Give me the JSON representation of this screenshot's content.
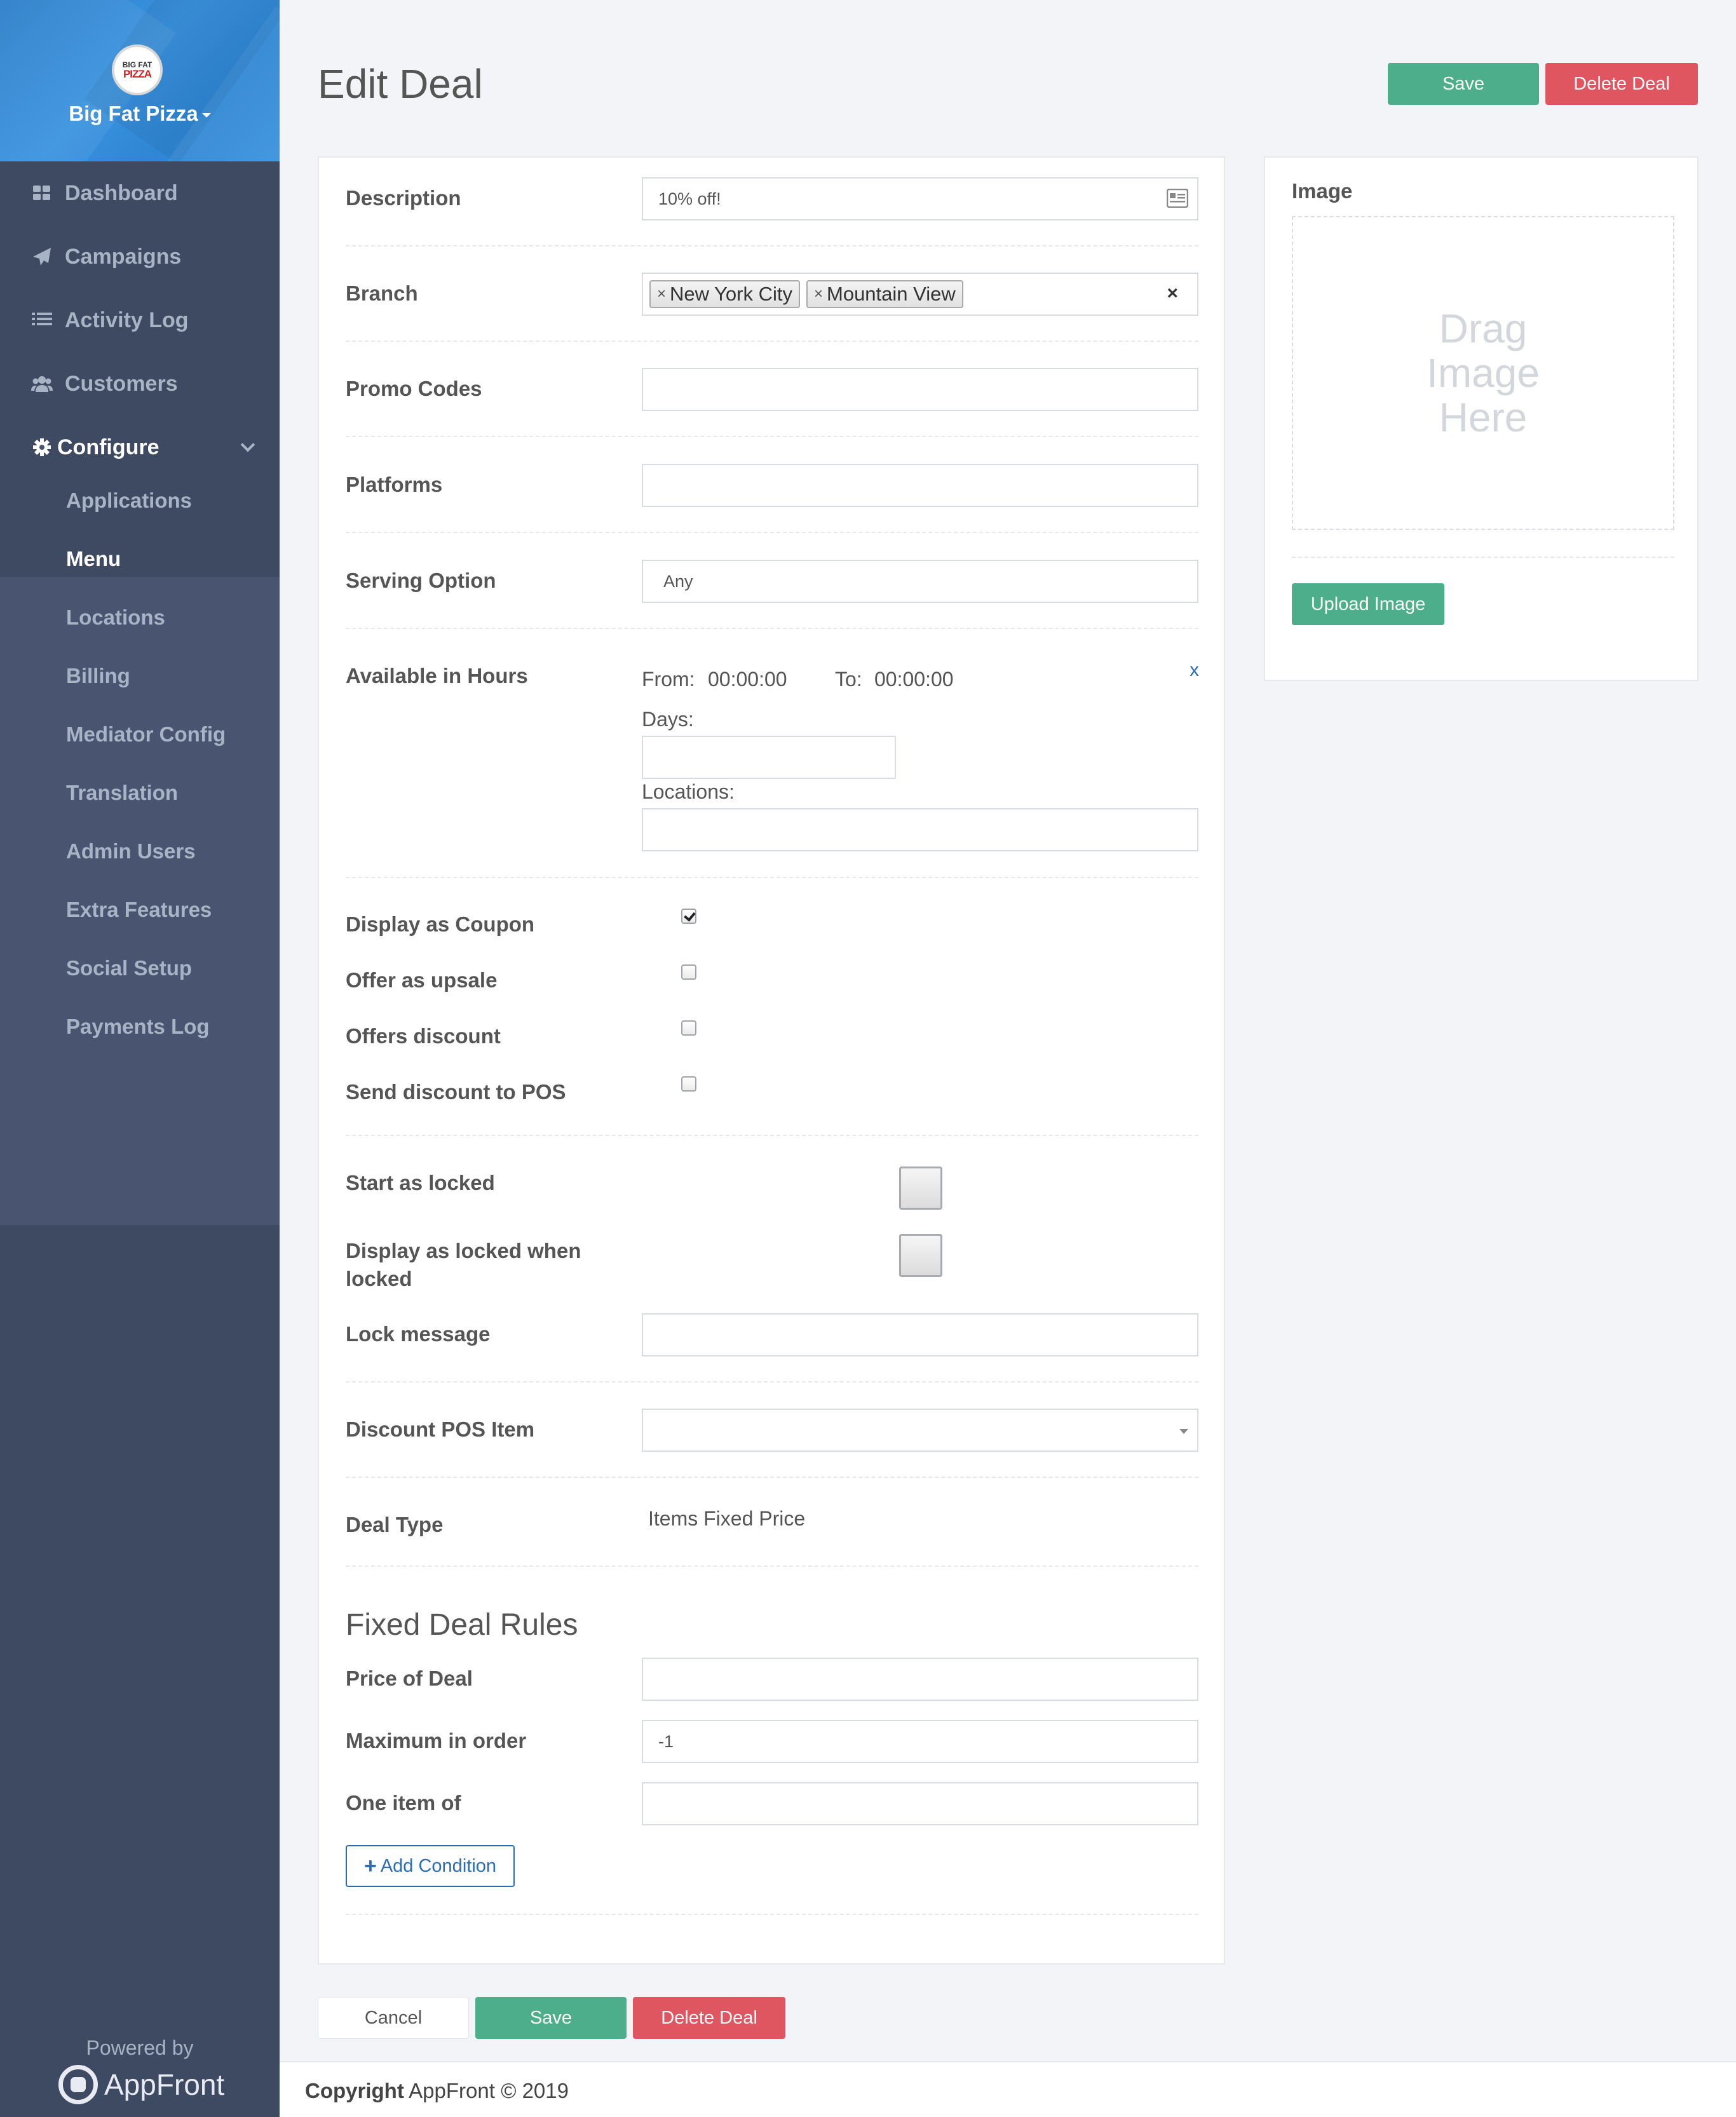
{
  "sidebar": {
    "logo_line1": "BIG FAT",
    "logo_line2": "PIZZA",
    "brand_name": "Big Fat Pizza",
    "nav": [
      {
        "label": "Dashboard",
        "icon": "dashboard-icon"
      },
      {
        "label": "Campaigns",
        "icon": "paper-plane-icon"
      },
      {
        "label": "Activity Log",
        "icon": "list-icon"
      },
      {
        "label": "Customers",
        "icon": "users-icon"
      },
      {
        "label": "Configure",
        "icon": "gear-icon",
        "expanded": true
      }
    ],
    "subnav": [
      "Applications",
      "Menu",
      "Locations",
      "Billing",
      "Mediator Config",
      "Translation",
      "Admin Users",
      "Extra Features",
      "Social Setup",
      "Payments Log"
    ],
    "active_subnav": "Menu",
    "powered_by": "Powered by",
    "powered_brand": "AppFront"
  },
  "header": {
    "title": "Edit Deal",
    "save_label": "Save",
    "delete_label": "Delete Deal"
  },
  "form": {
    "description": {
      "label": "Description",
      "value": "10% off!"
    },
    "branch": {
      "label": "Branch",
      "tags": [
        "New York City",
        "Mountain View"
      ],
      "clear": "×"
    },
    "promo_codes": {
      "label": "Promo Codes",
      "value": ""
    },
    "platforms": {
      "label": "Platforms",
      "value": ""
    },
    "serving_option": {
      "label": "Serving Option",
      "value": "Any"
    },
    "available_hours": {
      "label": "Available in Hours",
      "from_label": "From:",
      "from_value": "00:00:00",
      "to_label": "To:",
      "to_value": "00:00:00",
      "remove": "x",
      "days_label": "Days:",
      "locations_label": "Locations:"
    },
    "display_as_coupon": {
      "label": "Display as Coupon",
      "checked": true
    },
    "offer_as_upsale": {
      "label": "Offer as upsale",
      "checked": false
    },
    "offers_discount": {
      "label": "Offers discount",
      "checked": false
    },
    "send_discount_to_pos": {
      "label": "Send discount to POS",
      "checked": false
    },
    "start_as_locked": {
      "label": "Start as locked"
    },
    "display_as_locked": {
      "label_line1": "Display as locked when",
      "label_line2": "locked"
    },
    "lock_message": {
      "label": "Lock message",
      "value": ""
    },
    "discount_pos_item": {
      "label": "Discount POS Item",
      "value": ""
    },
    "deal_type": {
      "label": "Deal Type",
      "value": "Items Fixed Price"
    },
    "fixed_rules_heading": "Fixed Deal Rules",
    "price_of_deal": {
      "label": "Price of Deal",
      "value": ""
    },
    "maximum_in_order": {
      "label": "Maximum in order",
      "value": "-1"
    },
    "one_item_of": {
      "label": "One item of",
      "value": ""
    },
    "add_condition": "Add Condition"
  },
  "image_panel": {
    "label": "Image",
    "drop_line1": "Drag",
    "drop_line2": "Image",
    "drop_line3": "Here",
    "upload_label": "Upload Image"
  },
  "bottom_actions": {
    "cancel_label": "Cancel",
    "save_label": "Save",
    "delete_label": "Delete Deal"
  },
  "footer": {
    "copyright_bold": "Copyright",
    "copyright_text": " AppFront © 2019"
  },
  "colors": {
    "sidebar_bg": "#3e4962",
    "brand_blue": "#2f86d4",
    "save_green": "#4cae8a",
    "delete_red": "#e05660",
    "link_blue": "#2a6db5"
  }
}
